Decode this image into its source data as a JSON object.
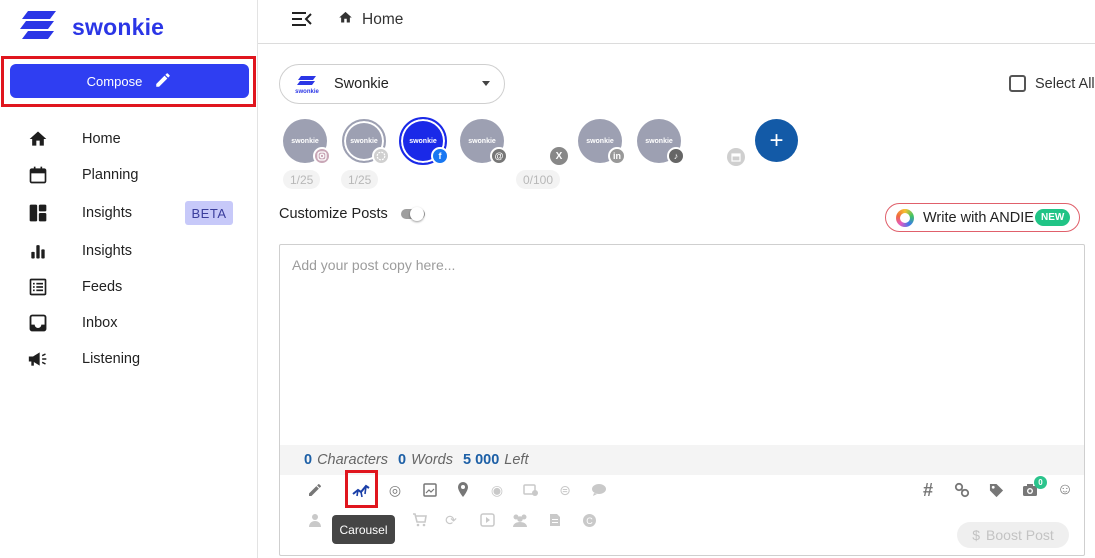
{
  "brand": {
    "name": "swonkie",
    "logo_icon": "swonkie-logo-icon"
  },
  "sidebar": {
    "compose_label": "Compose",
    "items": [
      {
        "label": "Home",
        "icon": "home-icon"
      },
      {
        "label": "Planning",
        "icon": "calendar-icon"
      },
      {
        "label": "Insights",
        "icon": "dashboard-icon",
        "badge": "BETA"
      },
      {
        "label": "Insights",
        "icon": "bar-chart-icon"
      },
      {
        "label": "Feeds",
        "icon": "list-icon"
      },
      {
        "label": "Inbox",
        "icon": "inbox-icon"
      },
      {
        "label": "Listening",
        "icon": "megaphone-icon"
      }
    ]
  },
  "topbar": {
    "breadcrumb": "Home"
  },
  "composer": {
    "brand_selector": {
      "value": "Swonkie",
      "logo_text": "swonkie"
    },
    "select_all_label": "Select All",
    "accounts": [
      {
        "name": "swonkie",
        "network": "instagram",
        "counter": "1/25"
      },
      {
        "name": "swonkie",
        "network": "instagram-story",
        "counter": "1/25"
      },
      {
        "name": "swonkie",
        "network": "facebook",
        "selected": true
      },
      {
        "name": "swonkie",
        "network": "threads",
        "counter": "0/100"
      },
      {
        "name": "",
        "network": "x"
      },
      {
        "name": "swonkie",
        "network": "linkedin"
      },
      {
        "name": "swonkie",
        "network": "tiktok"
      },
      {
        "name": "",
        "network": "google-business"
      }
    ],
    "add_account_label": "+",
    "customize_label": "Customize Posts",
    "andie": {
      "label": "Write with ANDIE",
      "badge": "NEW"
    },
    "editor": {
      "placeholder": "Add your post copy here..."
    },
    "stats": {
      "characters_value": "0",
      "characters_label": "Characters",
      "words_value": "0",
      "words_label": "Words",
      "left_value": "5 000",
      "left_label": "Left"
    },
    "toolbar": {
      "tooltip": "Carousel",
      "media_count": "0",
      "boost_label": "Boost Post"
    }
  },
  "colors": {
    "accent": "#2f3ef2",
    "highlight": "#e0161e",
    "navy": "#135aa7"
  }
}
